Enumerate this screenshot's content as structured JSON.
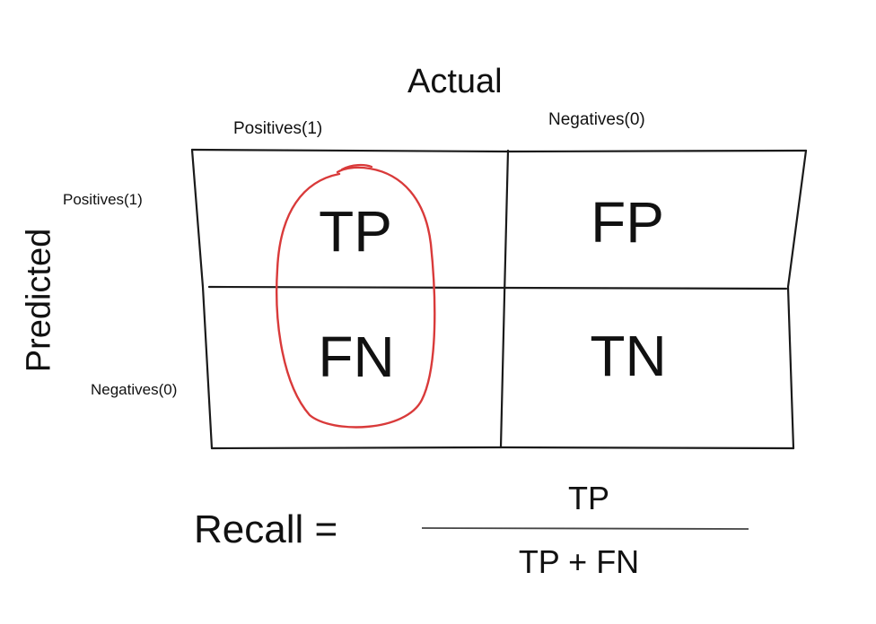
{
  "matrix": {
    "actual_title": "Actual",
    "predicted_title": "Predicted",
    "col_positive": "Positives(1)",
    "col_negative": "Negatives(0)",
    "row_positive": "Positives(1)",
    "row_negative": "Negatives(0)",
    "cells": {
      "tp": "TP",
      "fp": "FP",
      "fn": "FN",
      "tn": "TN"
    },
    "highlight_color": "#d93a3a"
  },
  "formula": {
    "label": "Recall =",
    "numerator": "TP",
    "denominator": "TP + FN"
  }
}
